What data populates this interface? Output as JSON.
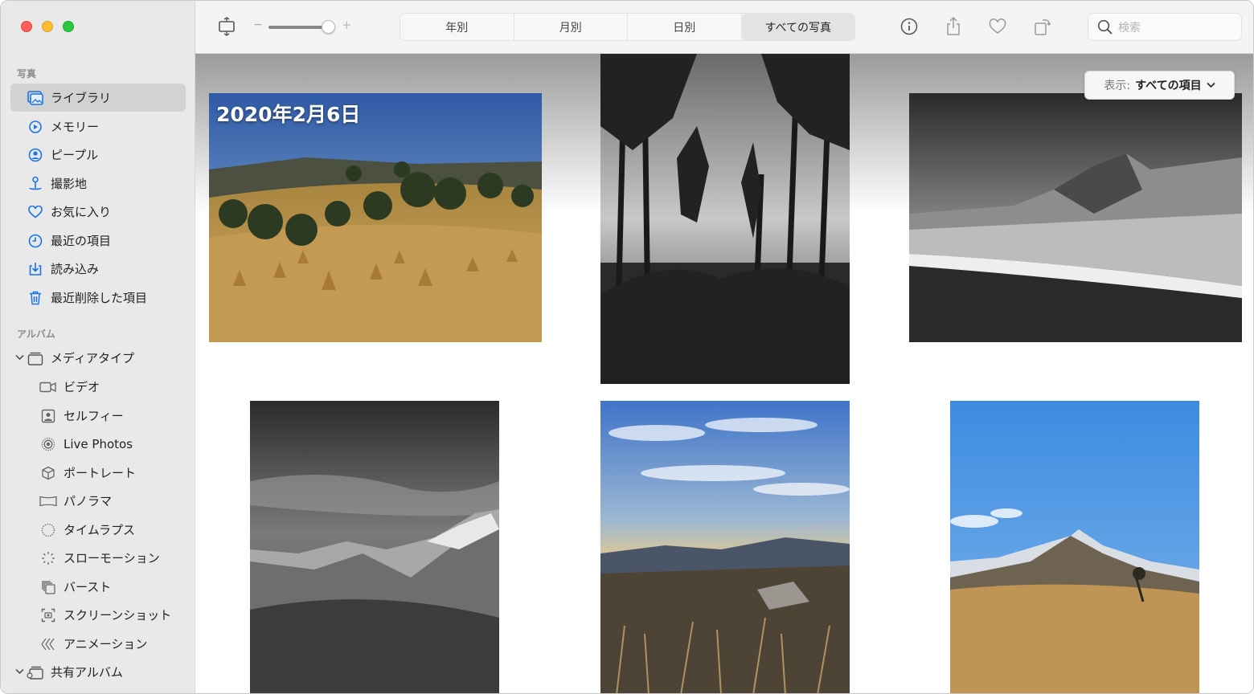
{
  "sidebar": {
    "section_photos": "写真",
    "items": [
      {
        "label": "ライブラリ",
        "icon": "photo-library-icon"
      },
      {
        "label": "メモリー",
        "icon": "memories-icon"
      },
      {
        "label": "ピープル",
        "icon": "people-icon"
      },
      {
        "label": "撮影地",
        "icon": "places-pin-icon"
      },
      {
        "label": "お気に入り",
        "icon": "heart-icon"
      },
      {
        "label": "最近の項目",
        "icon": "clock-icon"
      },
      {
        "label": "読み込み",
        "icon": "import-icon"
      },
      {
        "label": "最近削除した項目",
        "icon": "trash-icon"
      }
    ],
    "section_albums": "アルバム",
    "media_types": "メディアタイプ",
    "sub_items": [
      {
        "label": "ビデオ",
        "icon": "video-icon"
      },
      {
        "label": "セルフィー",
        "icon": "selfie-icon"
      },
      {
        "label": "Live Photos",
        "icon": "live-photos-icon"
      },
      {
        "label": "ポートレート",
        "icon": "portrait-cube-icon"
      },
      {
        "label": "パノラマ",
        "icon": "panorama-icon"
      },
      {
        "label": "タイムラプス",
        "icon": "timelapse-icon"
      },
      {
        "label": "スローモーション",
        "icon": "slomo-icon"
      },
      {
        "label": "バースト",
        "icon": "burst-icon"
      },
      {
        "label": "スクリーンショット",
        "icon": "screenshot-icon"
      },
      {
        "label": "アニメーション",
        "icon": "animation-icon"
      }
    ],
    "shared_albums": "共有アルバム"
  },
  "toolbar": {
    "zoom_minus": "−",
    "zoom_plus": "+",
    "zoom_level": 0.85,
    "tabs": [
      "年別",
      "月別",
      "日別",
      "すべての写真"
    ],
    "active_tab": "すべての写真",
    "search_placeholder": "検索"
  },
  "content": {
    "date_heading": "2020年2月6日",
    "filter_label": "表示:",
    "filter_value": "すべての項目"
  }
}
